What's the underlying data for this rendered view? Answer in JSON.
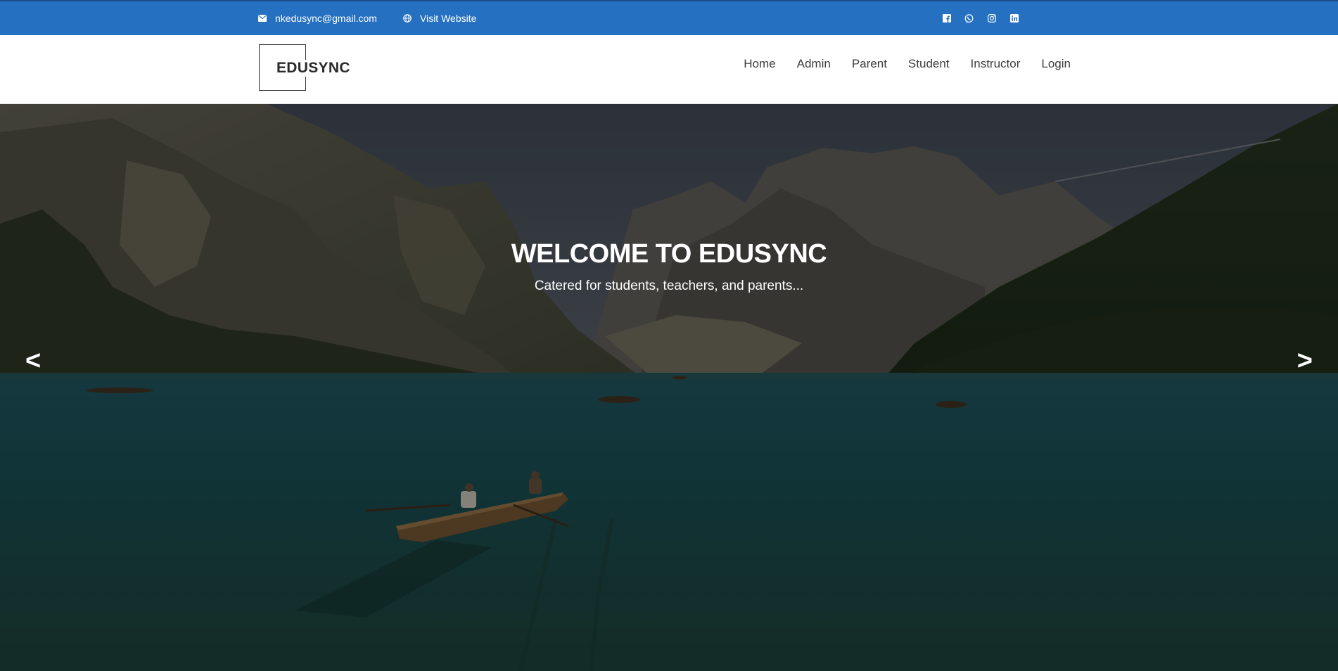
{
  "topbar": {
    "email": "nkedusync@gmail.com",
    "website_label": "Visit Website",
    "social_icons": [
      "facebook-icon",
      "viber-icon",
      "instagram-icon",
      "linkedin-icon"
    ],
    "background_color": "#2570c0"
  },
  "header": {
    "logo_text": "EDUSYNC",
    "nav": [
      {
        "label": "Home"
      },
      {
        "label": "Admin"
      },
      {
        "label": "Parent"
      },
      {
        "label": "Student"
      },
      {
        "label": "Instructor"
      },
      {
        "label": "Login"
      }
    ]
  },
  "hero": {
    "title": "WELCOME TO EDUSYNC",
    "subtitle": "Catered for students, teachers, and parents...",
    "prev_label": "<",
    "next_label": ">",
    "image_description_icon": "lake-mountains-boat-image"
  }
}
